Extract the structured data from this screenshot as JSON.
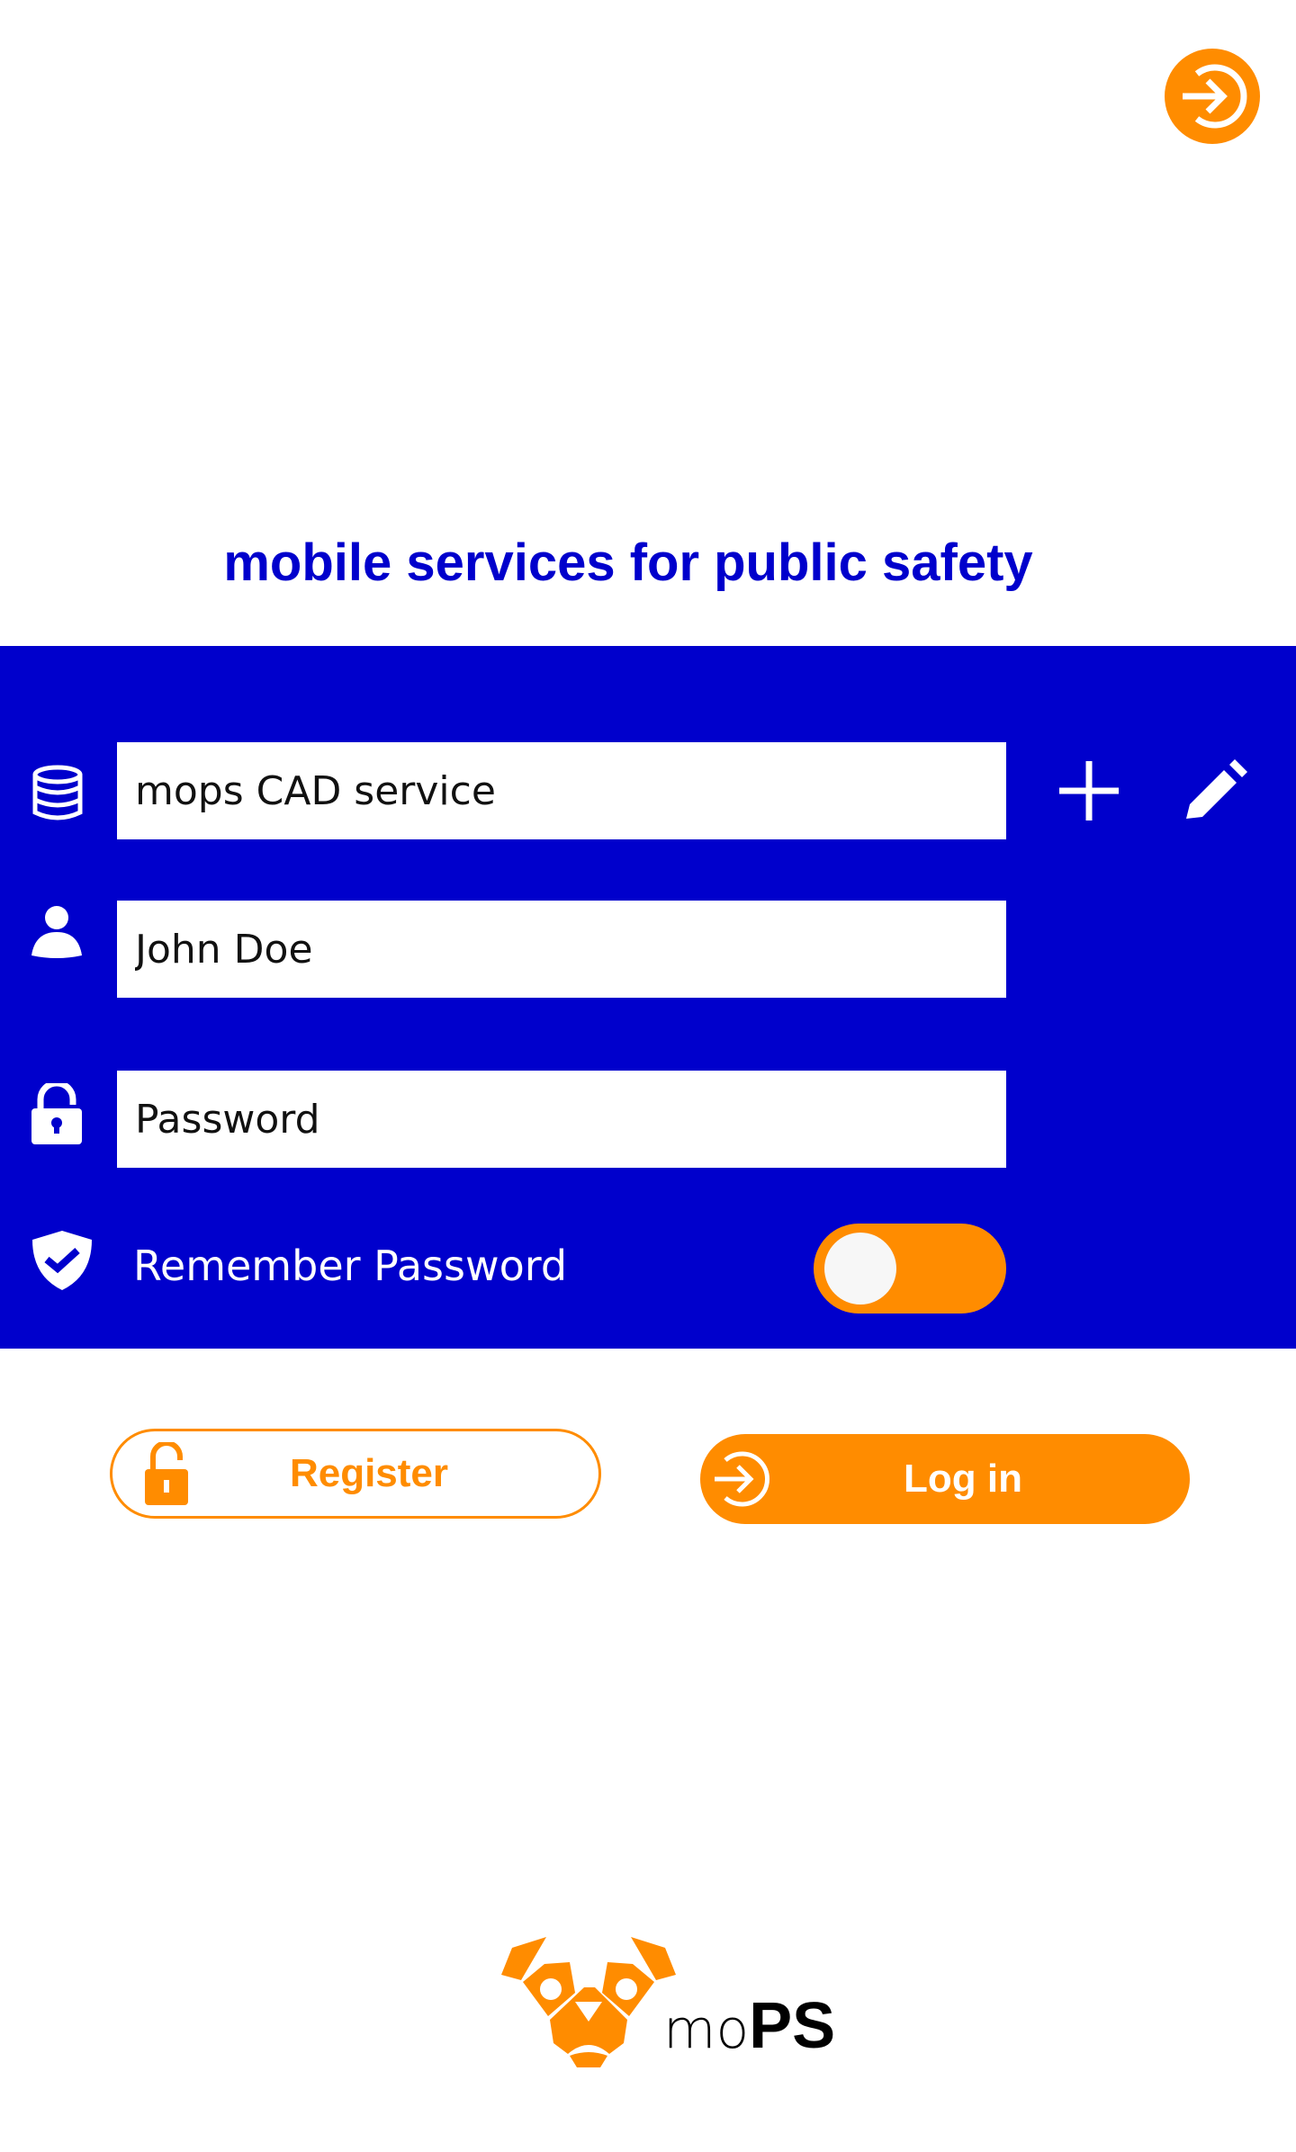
{
  "header": {
    "top_action_icon": "login-circle-arrow-icon"
  },
  "tagline": "mobile services for public safety",
  "form": {
    "service": {
      "value": "mops CAD service",
      "icon": "database-icon"
    },
    "add_icon": "plus-icon",
    "edit_icon": "pencil-icon",
    "username": {
      "value": "John Doe",
      "icon": "user-icon"
    },
    "password": {
      "value": "",
      "placeholder": "Password",
      "icon": "unlock-icon"
    },
    "remember": {
      "label": "Remember Password",
      "icon": "shield-check-icon",
      "enabled": true
    }
  },
  "buttons": {
    "register": "Register",
    "login": "Log in"
  },
  "logo": {
    "text_light": "mo",
    "text_bold": "PS"
  },
  "colors": {
    "primary": "#0000cc",
    "accent": "#ff8c00"
  }
}
